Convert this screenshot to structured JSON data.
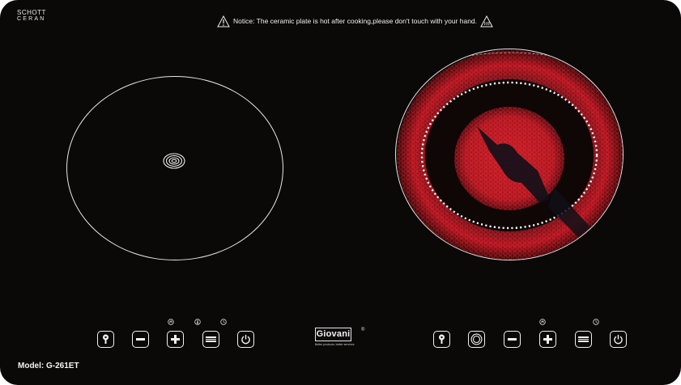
{
  "brand": {
    "line1": "SCHOTT",
    "line2": "CERAN"
  },
  "notice": "Notice: The ceramic plate is hot after cooking,please don't touch with your hand.",
  "logo": {
    "name": "Giovani",
    "registered": "®",
    "tagline": "Better products, better services"
  },
  "model": "Model: G-261ET",
  "colors": {
    "panel": "#0b0808",
    "line": "#e6e6e6",
    "heat": "#c0202a",
    "dots": "#f2f2f2"
  },
  "left_controls": [
    {
      "icon": "key-lock-icon"
    },
    {
      "icon": "minus-icon"
    },
    {
      "icon": "plus-icon",
      "indicator": "power-level-indicator-icon"
    },
    {
      "icon": "timer-bars-icon",
      "indicator": "temperature-indicator-icon"
    },
    {
      "icon": "power-icon",
      "indicator": "timer-indicator-icon"
    }
  ],
  "right_controls": [
    {
      "icon": "key-lock-icon"
    },
    {
      "icon": "dual-ring-icon"
    },
    {
      "icon": "minus-icon"
    },
    {
      "icon": "plus-icon",
      "indicator": "power-level-indicator-icon"
    },
    {
      "icon": "timer-bars-icon"
    },
    {
      "icon": "power-icon",
      "indicator": "timer-indicator-icon"
    }
  ]
}
